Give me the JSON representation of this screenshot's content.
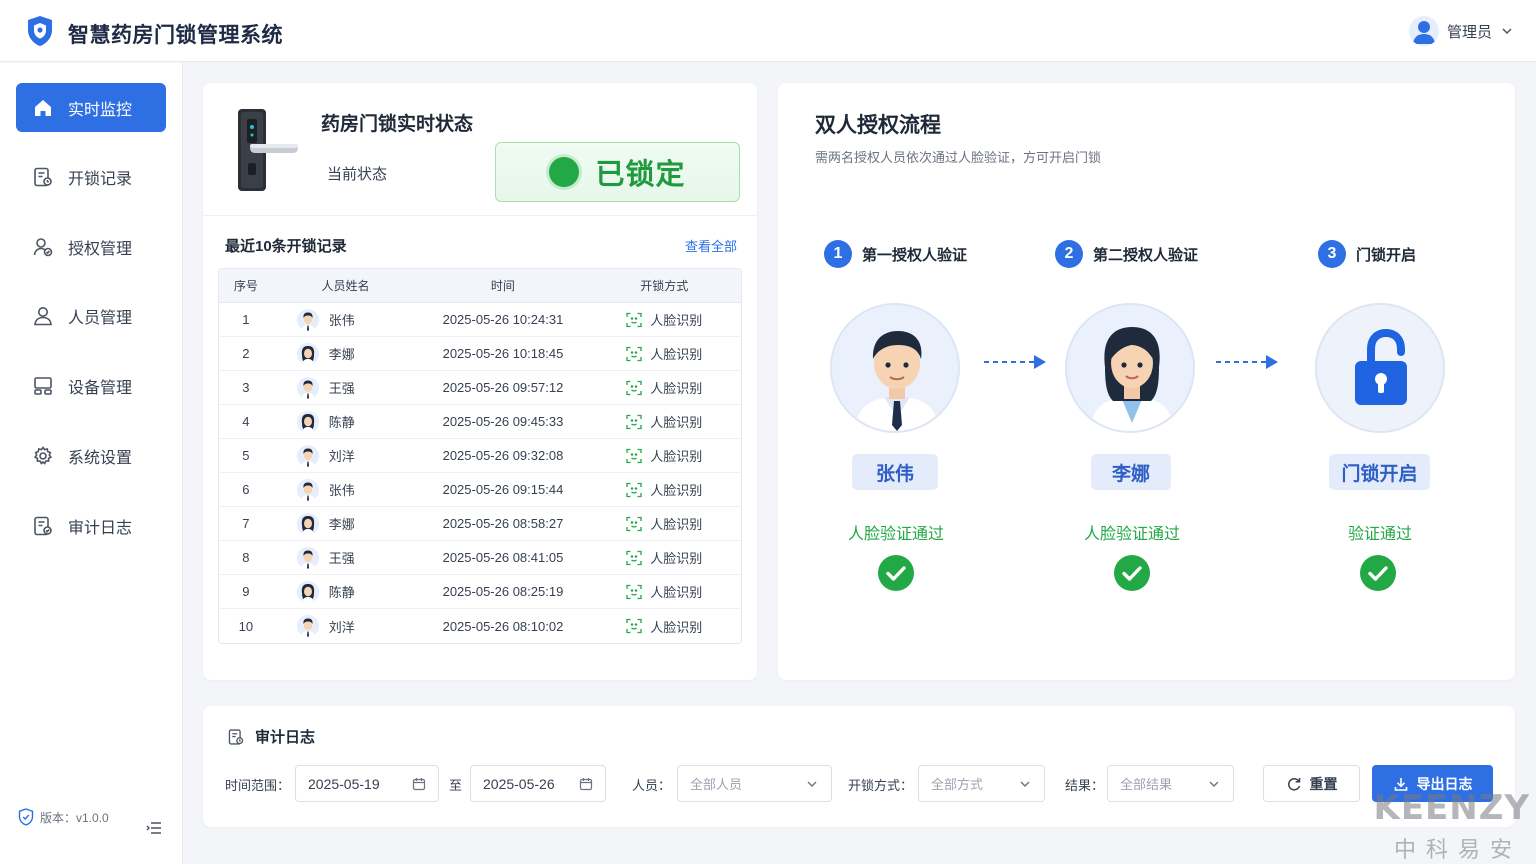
{
  "app": {
    "title": "智慧药房门锁管理系统"
  },
  "user": {
    "name": "管理员"
  },
  "sidebar": {
    "items": [
      {
        "label": "实时监控",
        "icon": "home-icon",
        "active": true
      },
      {
        "label": "开锁记录",
        "icon": "record-icon"
      },
      {
        "label": "授权管理",
        "icon": "user-auth-icon"
      },
      {
        "label": "人员管理",
        "icon": "user-icon"
      },
      {
        "label": "设备管理",
        "icon": "device-icon"
      },
      {
        "label": "系统设置",
        "icon": "gear-icon"
      },
      {
        "label": "审计日志",
        "icon": "audit-log-icon"
      }
    ],
    "version": "版本：v1.0.0"
  },
  "status": {
    "title": "药房门锁实时状态",
    "current_label": "当前状态",
    "current_value": "已锁定",
    "status_color": "#22a845"
  },
  "records": {
    "title": "最近10条开锁记录",
    "view_all": "查看全部",
    "columns": [
      "序号",
      "人员姓名",
      "时间",
      "开锁方式"
    ],
    "rows": [
      {
        "no": "1",
        "name": "张伟",
        "time": "2025-05-26 10:24:31",
        "method": "人脸识别"
      },
      {
        "no": "2",
        "name": "李娜",
        "time": "2025-05-26 10:18:45",
        "method": "人脸识别"
      },
      {
        "no": "3",
        "name": "王强",
        "time": "2025-05-26 09:57:12",
        "method": "人脸识别"
      },
      {
        "no": "4",
        "name": "陈静",
        "time": "2025-05-26 09:45:33",
        "method": "人脸识别"
      },
      {
        "no": "5",
        "name": "刘洋",
        "time": "2025-05-26 09:32:08",
        "method": "人脸识别"
      },
      {
        "no": "6",
        "name": "张伟",
        "time": "2025-05-26 09:15:44",
        "method": "人脸识别"
      },
      {
        "no": "7",
        "name": "李娜",
        "time": "2025-05-26 08:58:27",
        "method": "人脸识别"
      },
      {
        "no": "8",
        "name": "王强",
        "time": "2025-05-26 08:41:05",
        "method": "人脸识别"
      },
      {
        "no": "9",
        "name": "陈静",
        "time": "2025-05-26 08:25:19",
        "method": "人脸识别"
      },
      {
        "no": "10",
        "name": "刘洋",
        "time": "2025-05-26 08:10:02",
        "method": "人脸识别"
      }
    ]
  },
  "flow": {
    "title": "双人授权流程",
    "subtitle": "需两名授权人员依次通过人脸验证，方可开启门锁",
    "steps": [
      {
        "num": "1",
        "title": "第一授权人验证",
        "name": "张伟",
        "result": "人脸验证通过"
      },
      {
        "num": "2",
        "title": "第二授权人验证",
        "name": "李娜",
        "result": "人脸验证通过"
      },
      {
        "num": "3",
        "title": "门锁开启",
        "name": "门锁开启",
        "result": "验证通过"
      }
    ]
  },
  "audit": {
    "title": "审计日志",
    "time_range_label": "时间范围：",
    "date_from": "2025-05-19",
    "to_label": "至",
    "date_to": "2025-05-26",
    "person_label": "人员：",
    "person_placeholder": "全部人员",
    "method_label": "开锁方式：",
    "method_placeholder": "全部方式",
    "result_label": "结果：",
    "result_placeholder": "全部结果",
    "reset_label": "重置",
    "export_label": "导出日志"
  },
  "watermark": {
    "brand": "KEENZY",
    "brand_cn": "中科易安"
  },
  "colors": {
    "primary": "#2f6fe4",
    "success": "#22a845",
    "background": "#f3f5f9"
  }
}
